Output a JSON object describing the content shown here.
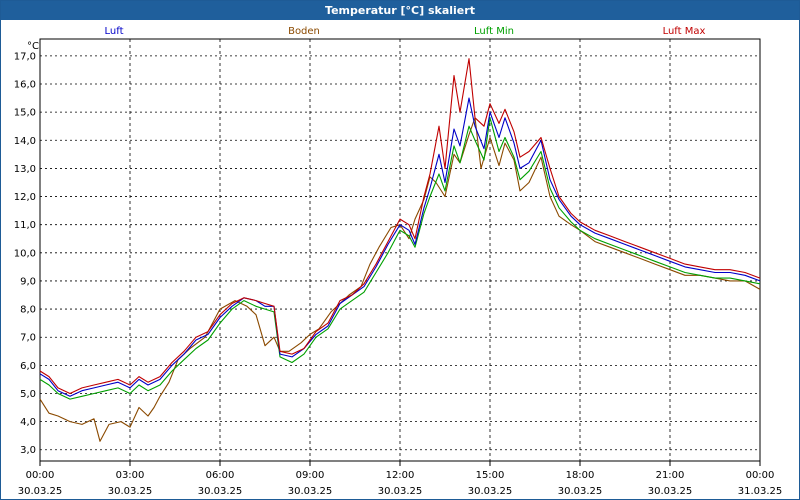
{
  "window": {
    "title": "Temperatur [°C] skaliert"
  },
  "chart_data": {
    "type": "line",
    "title": "Temperatur [°C] skaliert",
    "ylabel": "°C",
    "ylim": [
      2.6,
      17.6
    ],
    "grid": true,
    "legend_position": "top",
    "yticks": [
      3.0,
      4.0,
      5.0,
      6.0,
      7.0,
      8.0,
      9.0,
      10.0,
      11.0,
      12.0,
      13.0,
      14.0,
      15.0,
      16.0,
      17.0
    ],
    "ytick_labels": [
      "3,0",
      "4,0",
      "5,0",
      "6,0",
      "7,0",
      "8,0",
      "9,0",
      "10,0",
      "11,0",
      "12,0",
      "13,0",
      "14,0",
      "15,0",
      "16,0",
      "17,0"
    ],
    "xlim": [
      0,
      24
    ],
    "xticks": [
      0,
      3,
      6,
      9,
      12,
      15,
      18,
      21,
      24
    ],
    "xtick_times": [
      "00:00",
      "03:00",
      "06:00",
      "09:00",
      "12:00",
      "15:00",
      "18:00",
      "21:00",
      "00:00"
    ],
    "xtick_dates": [
      "30.03.25",
      "30.03.25",
      "30.03.25",
      "30.03.25",
      "30.03.25",
      "30.03.25",
      "30.03.25",
      "30.03.25",
      "31.03.25"
    ],
    "series": [
      {
        "name": "Boden",
        "color": "#8b4a00",
        "x": [
          0,
          0.3,
          0.6,
          1.0,
          1.4,
          1.8,
          2.0,
          2.3,
          2.7,
          3.0,
          3.3,
          3.6,
          3.8,
          4.0,
          4.3,
          4.6,
          5.0,
          5.5,
          6.0,
          6.5,
          6.9,
          7.2,
          7.5,
          7.8,
          8.0,
          8.3,
          8.7,
          9.0,
          9.3,
          9.7,
          10.0,
          10.3,
          10.7,
          11.0,
          11.3,
          11.7,
          12.0,
          12.3,
          12.5,
          12.8,
          13.0,
          13.2,
          13.5,
          13.8,
          14.0,
          14.3,
          14.5,
          14.7,
          15.0,
          15.3,
          15.5,
          15.8,
          16.0,
          16.3,
          16.7,
          17.0,
          17.3,
          17.7,
          18.0,
          18.5,
          19.0,
          19.5,
          20.0,
          20.5,
          21.0,
          21.5,
          22.0,
          22.5,
          23.0,
          23.5,
          24.0
        ],
        "y": [
          4.8,
          4.3,
          4.2,
          4.0,
          3.9,
          4.1,
          3.3,
          3.9,
          4.0,
          3.8,
          4.5,
          4.2,
          4.5,
          4.9,
          5.4,
          6.2,
          6.6,
          7.0,
          8.0,
          8.3,
          8.1,
          7.8,
          6.7,
          7.0,
          6.5,
          6.5,
          6.8,
          7.1,
          7.3,
          7.9,
          8.2,
          8.5,
          8.8,
          9.6,
          10.2,
          10.9,
          11.0,
          10.5,
          11.2,
          11.9,
          12.7,
          12.5,
          12.0,
          13.5,
          13.2,
          14.2,
          14.8,
          13.0,
          14.1,
          13.1,
          13.9,
          13.3,
          12.2,
          12.5,
          13.4,
          12.0,
          11.3,
          11.0,
          10.8,
          10.4,
          10.2,
          10.0,
          9.8,
          9.6,
          9.4,
          9.2,
          9.2,
          9.1,
          9.0,
          9.0,
          8.7
        ]
      },
      {
        "name": "Luft Min",
        "color": "#00a000",
        "x": [
          0,
          0.3,
          0.6,
          1.0,
          1.4,
          1.8,
          2.2,
          2.6,
          3.0,
          3.3,
          3.6,
          4.0,
          4.4,
          4.8,
          5.2,
          5.6,
          6.0,
          6.4,
          6.8,
          7.2,
          7.5,
          7.8,
          8.0,
          8.4,
          8.8,
          9.2,
          9.6,
          10.0,
          10.4,
          10.8,
          11.2,
          11.6,
          12.0,
          12.3,
          12.5,
          12.8,
          13.0,
          13.3,
          13.5,
          13.8,
          14.0,
          14.3,
          14.5,
          14.8,
          15.0,
          15.3,
          15.5,
          15.8,
          16.0,
          16.3,
          16.7,
          17.0,
          17.3,
          17.7,
          18.0,
          18.5,
          19.0,
          19.5,
          20.0,
          20.5,
          21.0,
          21.5,
          22.0,
          22.5,
          23.0,
          23.5,
          24.0
        ],
        "y": [
          5.5,
          5.3,
          5.0,
          4.8,
          4.9,
          5.0,
          5.1,
          5.2,
          5.0,
          5.3,
          5.1,
          5.3,
          5.8,
          6.2,
          6.6,
          6.9,
          7.5,
          8.0,
          8.3,
          8.1,
          8.0,
          7.9,
          6.3,
          6.1,
          6.4,
          7.0,
          7.3,
          8.0,
          8.3,
          8.6,
          9.3,
          10.0,
          10.8,
          10.6,
          10.2,
          11.4,
          12.0,
          12.8,
          12.2,
          13.8,
          13.2,
          14.5,
          14.0,
          13.3,
          14.8,
          13.6,
          14.1,
          13.4,
          12.6,
          12.9,
          13.6,
          12.3,
          11.6,
          11.1,
          10.8,
          10.5,
          10.3,
          10.1,
          9.9,
          9.7,
          9.5,
          9.3,
          9.2,
          9.1,
          9.1,
          9.0,
          8.9
        ]
      },
      {
        "name": "Luft",
        "color": "#0000c8",
        "x": [
          0,
          0.3,
          0.6,
          1.0,
          1.4,
          1.8,
          2.2,
          2.6,
          3.0,
          3.3,
          3.6,
          4.0,
          4.4,
          4.8,
          5.2,
          5.6,
          6.0,
          6.4,
          6.8,
          7.2,
          7.5,
          7.8,
          8.0,
          8.4,
          8.8,
          9.2,
          9.6,
          10.0,
          10.4,
          10.8,
          11.2,
          11.6,
          12.0,
          12.3,
          12.5,
          12.8,
          13.0,
          13.3,
          13.5,
          13.8,
          14.0,
          14.3,
          14.5,
          14.8,
          15.0,
          15.3,
          15.5,
          15.8,
          16.0,
          16.3,
          16.7,
          17.0,
          17.3,
          17.7,
          18.0,
          18.5,
          19.0,
          19.5,
          20.0,
          20.5,
          21.0,
          21.5,
          22.0,
          22.5,
          23.0,
          23.5,
          24.0
        ],
        "y": [
          5.7,
          5.5,
          5.1,
          4.9,
          5.1,
          5.2,
          5.3,
          5.4,
          5.2,
          5.5,
          5.3,
          5.5,
          6.0,
          6.4,
          6.9,
          7.1,
          7.7,
          8.1,
          8.4,
          8.3,
          8.1,
          8.1,
          6.4,
          6.3,
          6.6,
          7.1,
          7.4,
          8.2,
          8.5,
          8.8,
          9.5,
          10.3,
          11.0,
          10.8,
          10.3,
          11.6,
          12.3,
          13.5,
          12.5,
          14.4,
          13.8,
          15.5,
          14.5,
          13.7,
          15.0,
          14.1,
          14.8,
          13.9,
          13.0,
          13.2,
          14.0,
          12.6,
          11.9,
          11.3,
          11.0,
          10.7,
          10.5,
          10.3,
          10.1,
          9.9,
          9.7,
          9.5,
          9.4,
          9.3,
          9.3,
          9.2,
          9.0
        ]
      },
      {
        "name": "Luft Max",
        "color": "#c00000",
        "x": [
          0,
          0.3,
          0.6,
          1.0,
          1.4,
          1.8,
          2.2,
          2.6,
          3.0,
          3.3,
          3.6,
          4.0,
          4.4,
          4.8,
          5.2,
          5.6,
          6.0,
          6.4,
          6.8,
          7.2,
          7.5,
          7.8,
          8.0,
          8.4,
          8.8,
          9.2,
          9.6,
          10.0,
          10.4,
          10.8,
          11.2,
          11.6,
          12.0,
          12.3,
          12.5,
          12.8,
          13.0,
          13.3,
          13.5,
          13.8,
          14.0,
          14.3,
          14.5,
          14.8,
          15.0,
          15.3,
          15.5,
          15.8,
          16.0,
          16.3,
          16.7,
          17.0,
          17.3,
          17.7,
          18.0,
          18.5,
          19.0,
          19.5,
          20.0,
          20.5,
          21.0,
          21.5,
          22.0,
          22.5,
          23.0,
          23.5,
          24.0
        ],
        "y": [
          5.8,
          5.6,
          5.2,
          5.0,
          5.2,
          5.3,
          5.4,
          5.5,
          5.3,
          5.6,
          5.4,
          5.6,
          6.1,
          6.5,
          7.0,
          7.2,
          7.8,
          8.2,
          8.4,
          8.3,
          8.2,
          8.1,
          6.5,
          6.4,
          6.6,
          7.2,
          7.5,
          8.3,
          8.5,
          8.9,
          9.6,
          10.4,
          11.2,
          11.0,
          10.5,
          12.0,
          12.8,
          14.5,
          13.0,
          16.3,
          15.0,
          16.9,
          14.8,
          14.5,
          15.3,
          14.6,
          15.1,
          14.3,
          13.4,
          13.6,
          14.1,
          13.0,
          12.0,
          11.4,
          11.1,
          10.8,
          10.6,
          10.4,
          10.2,
          10.0,
          9.8,
          9.6,
          9.5,
          9.4,
          9.4,
          9.3,
          9.1
        ]
      }
    ]
  }
}
